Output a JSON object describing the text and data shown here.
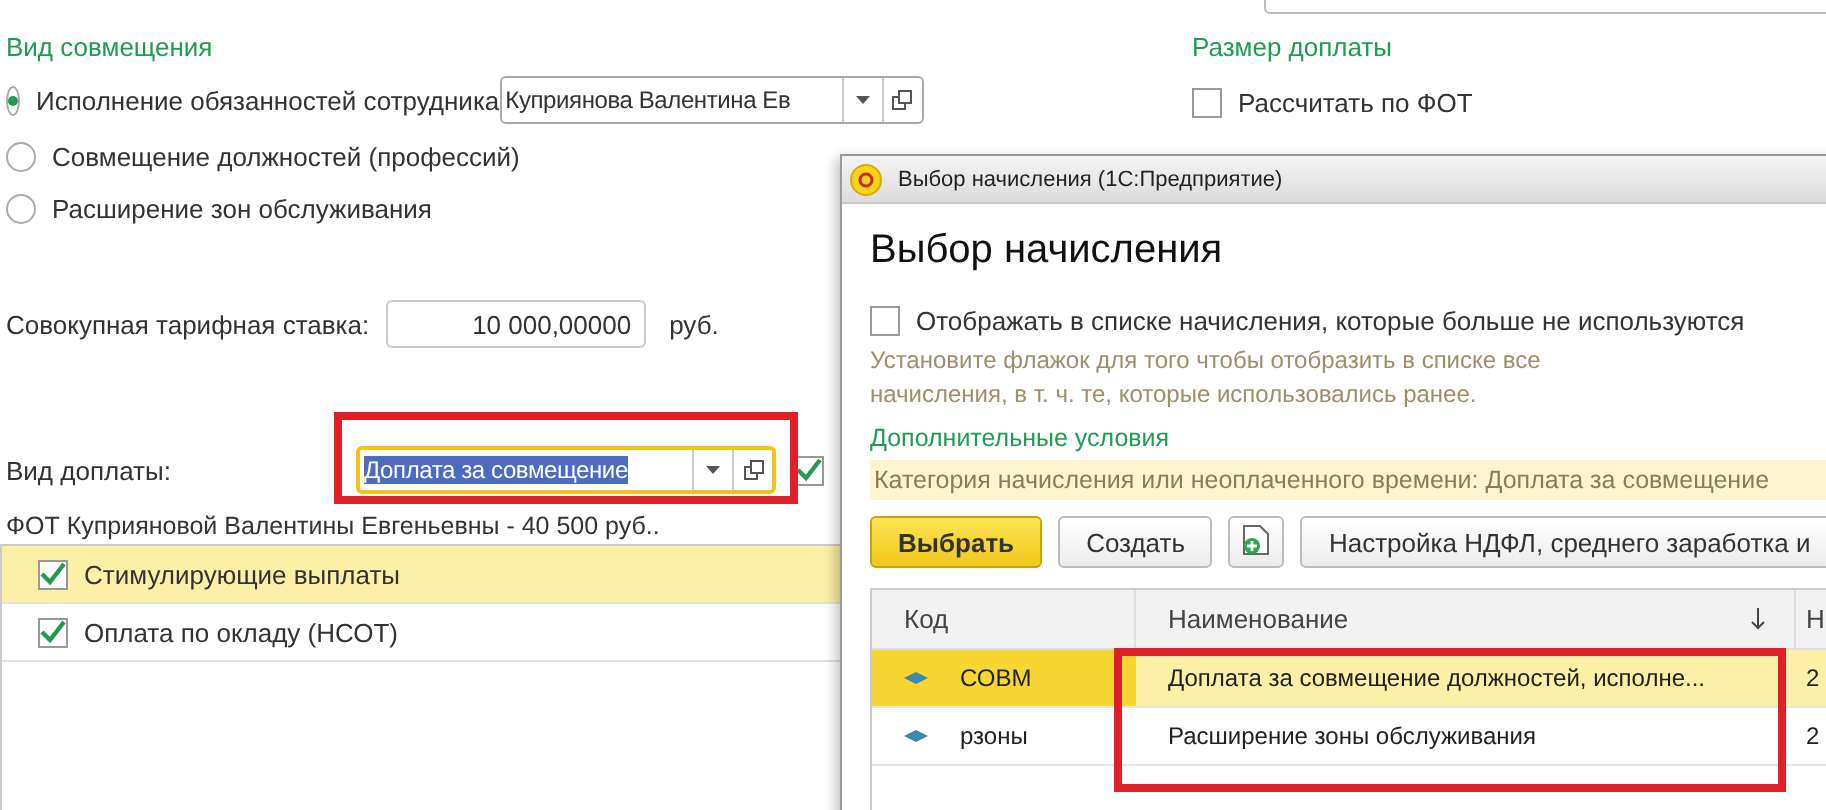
{
  "form": {
    "section_title": "Вид совмещения",
    "options": [
      {
        "label": "Исполнение обязанностей сотрудника",
        "selected": true
      },
      {
        "label": "Совмещение должностей (профессий)",
        "selected": false
      },
      {
        "label": "Расширение зон обслуживания",
        "selected": false
      }
    ],
    "employee_field": {
      "value": "Куприянова Валентина Ев"
    },
    "rate": {
      "label": "Совокупная тарифная ставка:",
      "value": "10 000,00000",
      "unit": "руб."
    },
    "payment_type": {
      "label": "Вид доплаты:",
      "value": "Доплата за совмещение",
      "checked": true
    },
    "fot_label": "ФОТ Куприяновой Валентины Евгеньевны - 40 500 руб..",
    "accruals": [
      {
        "label": "Стимулирующие выплаты",
        "checked": true,
        "selected": true
      },
      {
        "label": "Оплата по окладу (НСОТ)",
        "checked": true,
        "selected": false
      }
    ],
    "size_title": "Размер доплаты",
    "size_checkbox": {
      "label": "Рассчитать по ФОТ",
      "checked": false
    }
  },
  "dialog": {
    "window_title": "Выбор начисления  (1С:Предприятие)",
    "heading": "Выбор начисления",
    "show_unused": {
      "label": "Отображать в списке начисления, которые больше не используются",
      "checked": false
    },
    "hint": "Установите флажок для того чтобы отобразить в списке все начисления, в т. ч. те, которые использовались ранее.",
    "conditions_title": "Дополнительные условия",
    "category": "Категория начисления или неоплаченного времени: Доплата за совмещение",
    "buttons": [
      {
        "kind": "primary",
        "label": "Выбрать"
      },
      {
        "kind": "normal",
        "label": "Создать"
      },
      {
        "kind": "icon"
      },
      {
        "kind": "normal",
        "label": "Настройка НДФЛ, среднего заработка и"
      }
    ],
    "table": {
      "columns": [
        "Код",
        "Наименование",
        "Н"
      ],
      "rows": [
        {
          "cells": [
            "СОВМ",
            "Доплата за совмещение должностей, исполне...",
            "2"
          ],
          "selected": true
        },
        {
          "cells": [
            "рзоны",
            "Расширение зоны обслуживания",
            "2"
          ],
          "selected": false
        }
      ]
    }
  }
}
